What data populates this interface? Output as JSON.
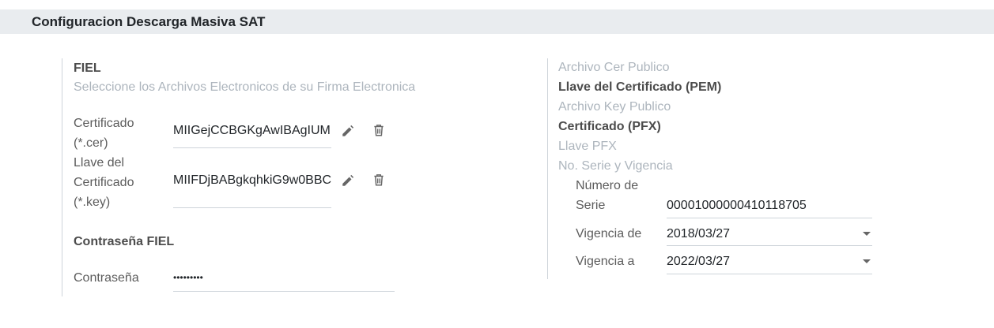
{
  "header": {
    "title": "Configuracion Descarga Masiva SAT"
  },
  "fiel": {
    "title": "FIEL",
    "subtitle": "Seleccione los Archivos Electronicos de su Firma Electronica",
    "cert_label_line1": "Certificado",
    "cert_label_line2": "(*.cer)",
    "cert_value": "MIIGejCCBGKgAwIBAgIUM",
    "key_label_line1": "Llave del",
    "key_label_line2": "Certificado",
    "key_label_line3": "(*.key)",
    "key_value": "MIIFDjBABgkqhkiG9w0BBC",
    "password_section": "Contraseña FIEL",
    "password_label": "Contraseña",
    "password_value": "•••••••••"
  },
  "right": {
    "archivo_cer_publico": "Archivo Cer Publico",
    "llave_pem": "Llave del Certificado (PEM)",
    "archivo_key_publico": "Archivo Key Publico",
    "certificado_pfx": "Certificado (PFX)",
    "llave_pfx": "Llave PFX",
    "serie_vigencia": "No. Serie y Vigencia",
    "numero_serie_label_line1": "Número de",
    "numero_serie_label_line2": "Serie",
    "numero_serie_value": "00001000000410118705",
    "vigencia_de_label": "Vigencia de",
    "vigencia_de_value": "2018/03/27",
    "vigencia_a_label": "Vigencia a",
    "vigencia_a_value": "2022/03/27"
  },
  "icons": {
    "edit": "pencil-icon",
    "delete": "trash-icon",
    "dropdown": "caret-down-icon"
  }
}
